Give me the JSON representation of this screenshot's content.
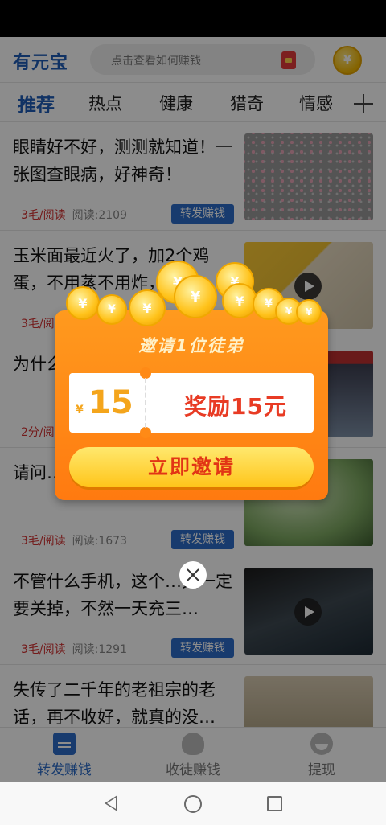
{
  "header": {
    "logo": "有元宝",
    "search_placeholder": "点击查看如何赚钱",
    "envelope_icon": "red-envelope-icon",
    "coin_icon": "gold-coin-icon",
    "coin_glyph": "¥"
  },
  "tabs": [
    {
      "label": "推荐",
      "active": true
    },
    {
      "label": "热点",
      "active": false
    },
    {
      "label": "健康",
      "active": false
    },
    {
      "label": "猎奇",
      "active": false
    },
    {
      "label": "情感",
      "active": false
    }
  ],
  "add_tab_icon": "plus-icon",
  "articles": [
    {
      "title": "眼睛好不好，测测就知道！一张图查眼病，好神奇！",
      "reward": "3毛/阅读",
      "reads": "阅读:2109",
      "share_label": "转发赚钱",
      "video": false
    },
    {
      "title": "玉米面最近火了，加2个鸡蛋，不用蒸不用炸，做",
      "reward": "3毛/阅读",
      "reads": "",
      "share_label": "",
      "video": true
    },
    {
      "title": "为什么……138步",
      "reward": "2分/阅读",
      "reads": "",
      "share_label": "",
      "video": false
    },
    {
      "title": "请问…有3人能猜出来？",
      "reward": "3毛/阅读",
      "reads": "阅读:1673",
      "share_label": "转发赚钱",
      "video": false
    },
    {
      "title": "不管什么手机，这个…关一定要关掉，不然一天充三…",
      "reward": "3毛/阅读",
      "reads": "阅读:1291",
      "share_label": "转发赚钱",
      "video": true
    },
    {
      "title": "失传了二千年的老祖宗的老话，再不收好，就真的没…",
      "reward": "",
      "reads": "",
      "share_label": "",
      "video": false
    }
  ],
  "bottom_nav": [
    {
      "label": "转发赚钱",
      "icon": "news-icon",
      "active": true
    },
    {
      "label": "收徒赚钱",
      "icon": "people-icon",
      "active": false
    },
    {
      "label": "提现",
      "icon": "withdraw-icon",
      "active": false
    }
  ],
  "popup": {
    "title": "邀请1位徒弟",
    "yen": "¥",
    "amount": "15",
    "reward_text": "奖励15元",
    "button_label": "立即邀请",
    "coin_glyph": "¥"
  },
  "colors": {
    "brand": "#1e5bb6",
    "share_button": "#2d6cc8",
    "reward_red": "#d23232",
    "popup_orange": "#ff8a16",
    "button_yellow": "#ffc51a"
  }
}
